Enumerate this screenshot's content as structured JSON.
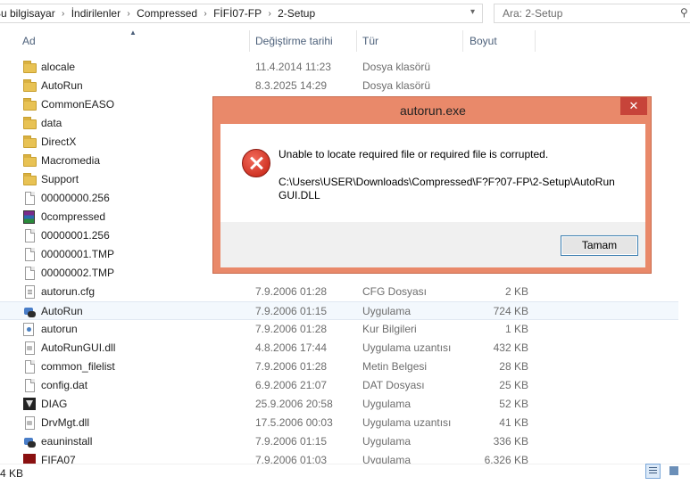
{
  "breadcrumb": [
    "Bu bilgisayar",
    "İndirilenler",
    "Compressed",
    "FİFİ07-FP",
    "2-Setup"
  ],
  "search": {
    "placeholder": "Ara: 2-Setup"
  },
  "columns": {
    "name": "Ad",
    "date": "Değiştirme tarihi",
    "type": "Tür",
    "size": "Boyut"
  },
  "files": [
    {
      "name": "alocale",
      "date": "11.4.2014 11:23",
      "type": "Dosya klasörü",
      "size": "",
      "icon": "folder-icon"
    },
    {
      "name": "AutoRun",
      "date": "8.3.2025 14:29",
      "type": "Dosya klasörü",
      "size": "",
      "icon": "folder-icon"
    },
    {
      "name": "CommonEASO",
      "date": "",
      "type": "",
      "size": "",
      "icon": "folder-icon"
    },
    {
      "name": "data",
      "date": "",
      "type": "",
      "size": "",
      "icon": "folder-icon"
    },
    {
      "name": "DirectX",
      "date": "",
      "type": "",
      "size": "",
      "icon": "folder-icon"
    },
    {
      "name": "Macromedia",
      "date": "",
      "type": "",
      "size": "",
      "icon": "folder-icon"
    },
    {
      "name": "Support",
      "date": "",
      "type": "",
      "size": "",
      "icon": "folder-icon"
    },
    {
      "name": "00000000.256",
      "date": "",
      "type": "",
      "size": "",
      "icon": "file-icon"
    },
    {
      "name": "0compressed",
      "date": "",
      "type": "",
      "size": "",
      "icon": "rar-icon"
    },
    {
      "name": "00000001.256",
      "date": "",
      "type": "",
      "size": "",
      "icon": "file-icon"
    },
    {
      "name": "00000001.TMP",
      "date": "",
      "type": "",
      "size": "",
      "icon": "file-icon"
    },
    {
      "name": "00000002.TMP",
      "date": "",
      "type": "",
      "size": "",
      "icon": "file-icon"
    },
    {
      "name": "autorun.cfg",
      "date": "7.9.2006 01:28",
      "type": "CFG Dosyası",
      "size": "2 KB",
      "icon": "cfg-icon"
    },
    {
      "name": "AutoRun",
      "date": "7.9.2006 01:15",
      "type": "Uygulama",
      "size": "724 KB",
      "icon": "app-icon",
      "selected": true
    },
    {
      "name": "autorun",
      "date": "7.9.2006 01:28",
      "type": "Kur Bilgileri",
      "size": "1 KB",
      "icon": "inf-icon"
    },
    {
      "name": "AutoRunGUI.dll",
      "date": "4.8.2006 17:44",
      "type": "Uygulama uzantısı",
      "size": "432 KB",
      "icon": "dll-icon"
    },
    {
      "name": "common_filelist",
      "date": "7.9.2006 01:28",
      "type": "Metin Belgesi",
      "size": "28 KB",
      "icon": "file-icon"
    },
    {
      "name": "config.dat",
      "date": "6.9.2006 21:07",
      "type": "DAT Dosyası",
      "size": "25 KB",
      "icon": "file-icon"
    },
    {
      "name": "DIAG",
      "date": "25.9.2006 20:58",
      "type": "Uygulama",
      "size": "52 KB",
      "icon": "diag-icon"
    },
    {
      "name": "DrvMgt.dll",
      "date": "17.5.2006 00:03",
      "type": "Uygulama uzantısı",
      "size": "41 KB",
      "icon": "dll-icon"
    },
    {
      "name": "eauninstall",
      "date": "7.9.2006 01:15",
      "type": "Uygulama",
      "size": "336 KB",
      "icon": "app-icon"
    },
    {
      "name": "FIFA07",
      "date": "7.9.2006 01:03",
      "type": "Uygulama",
      "size": "6.326 KB",
      "icon": "fifa-icon"
    }
  ],
  "status": {
    "text": "4 KB"
  },
  "dialog": {
    "title": "autorun.exe",
    "close": "✕",
    "message": "Unable to locate required file or required file is corrupted.",
    "path": "C:\\Users\\USER\\Downloads\\Compressed\\F?F?07-FP\\2-Setup\\AutoRunGUI.DLL",
    "ok_label": "Tamam"
  }
}
